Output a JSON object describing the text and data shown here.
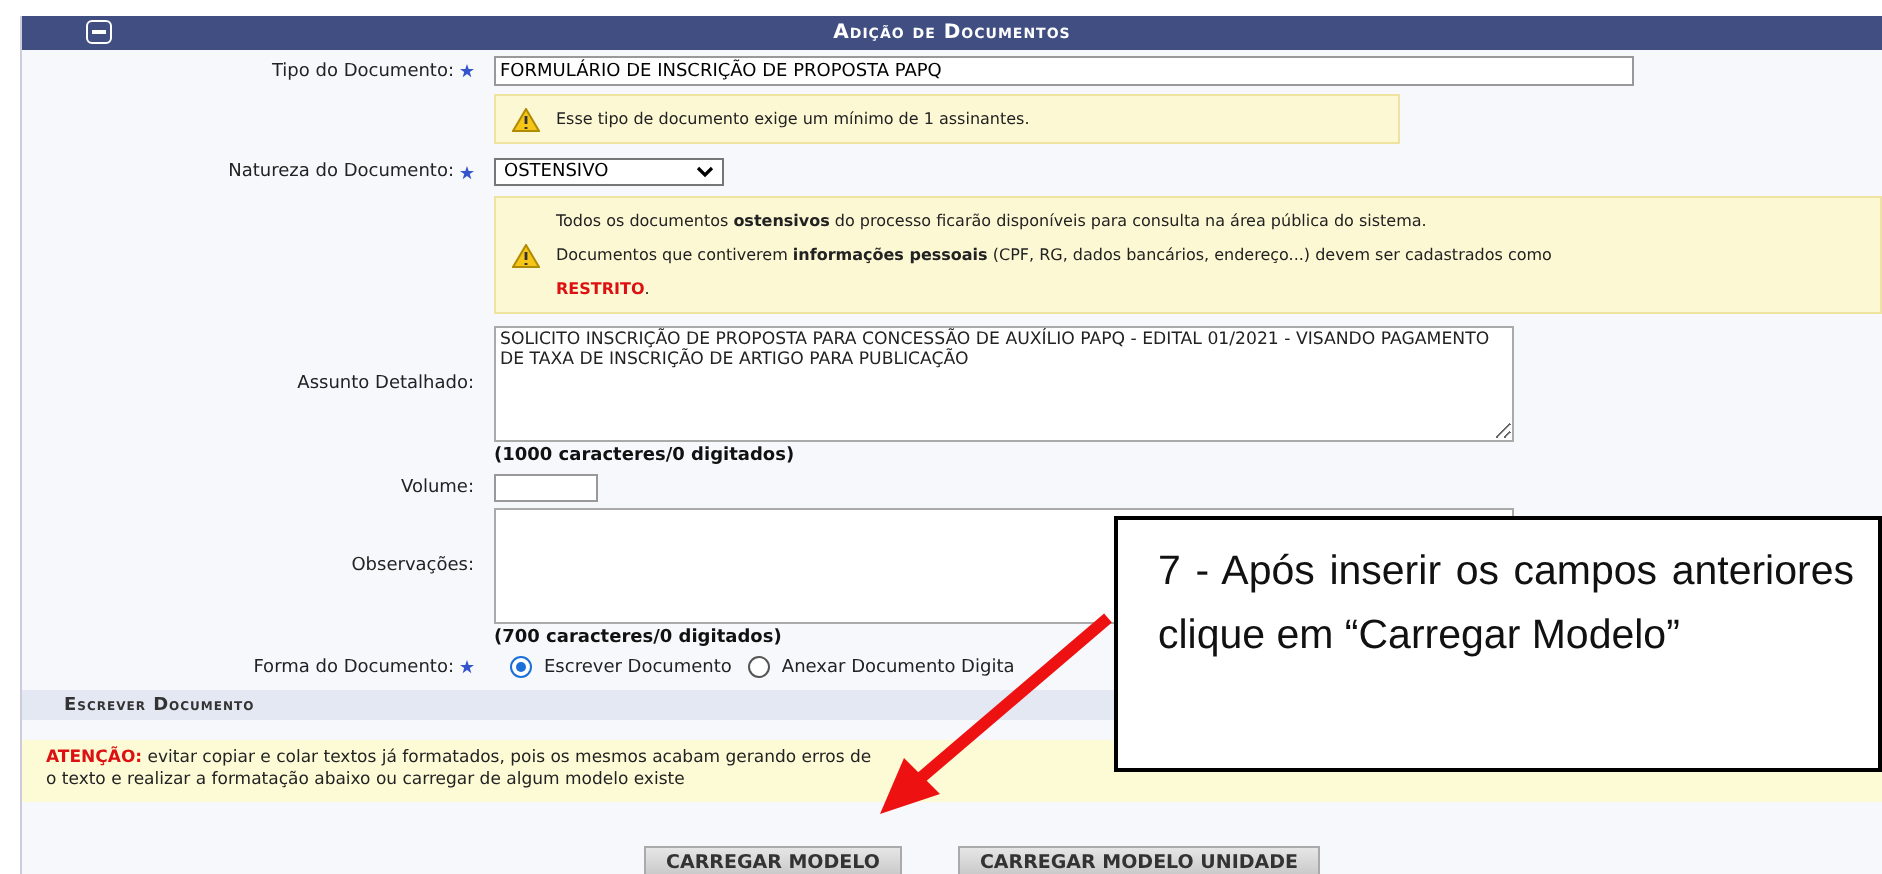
{
  "panel": {
    "title": "Adição de Documentos"
  },
  "tipo": {
    "label": "Tipo do Documento:",
    "required": true,
    "value": "FORMULÁRIO DE INSCRIÇÃO DE PROPOSTA PAPQ",
    "warning": "Esse tipo de documento exige um mínimo de 1 assinantes."
  },
  "natureza": {
    "label": "Natureza do Documento:",
    "required": true,
    "value": "OSTENSIVO",
    "notes": [
      "Todos os documentos **ostensivos** do processo ficarão disponíveis para consulta na área pública do sistema.",
      "Documentos que contiverem **informações pessoais** (CPF, RG, dados bancários, endereço...) devem ser cadastrados como"
    ],
    "restricted": "RESTRITO",
    "period": "."
  },
  "assunto": {
    "label": "Assunto Detalhado:",
    "value": "SOLICITO INSCRIÇÃO DE PROPOSTA PARA CONCESSÃO DE AUXÍLIO PAPQ - EDITAL 01/2021 - VISANDO PAGAMENTO DE TAXA DE INSCRIÇÃO DE ARTIGO PARA PUBLICAÇÃO",
    "counter": "(1000 caracteres/0 digitados)"
  },
  "volume": {
    "label": "Volume:"
  },
  "observacoes": {
    "label": "Observações:",
    "counter": "(700 caracteres/0 digitados)"
  },
  "forma": {
    "label": "Forma do Documento:",
    "required": true,
    "options": [
      {
        "label": "Escrever Documento",
        "selected": true
      },
      {
        "label": "Anexar Documento Digita",
        "selected": false
      }
    ]
  },
  "section": {
    "title": "Escrever Documento"
  },
  "notice": {
    "label": "ATENÇÃO:",
    "lines": [
      "evitar copiar e colar textos já formatados, pois os mesmos acabam gerando erros de",
      "o texto e realizar a formatação abaixo ou carregar de algum modelo existe"
    ]
  },
  "buttons": [
    "CARREGAR MODELO",
    "CARREGAR MODELO UNIDADE"
  ],
  "callout": {
    "text": "7 - Após inserir os campos anteriores clique em “Carregar Modelo”"
  }
}
